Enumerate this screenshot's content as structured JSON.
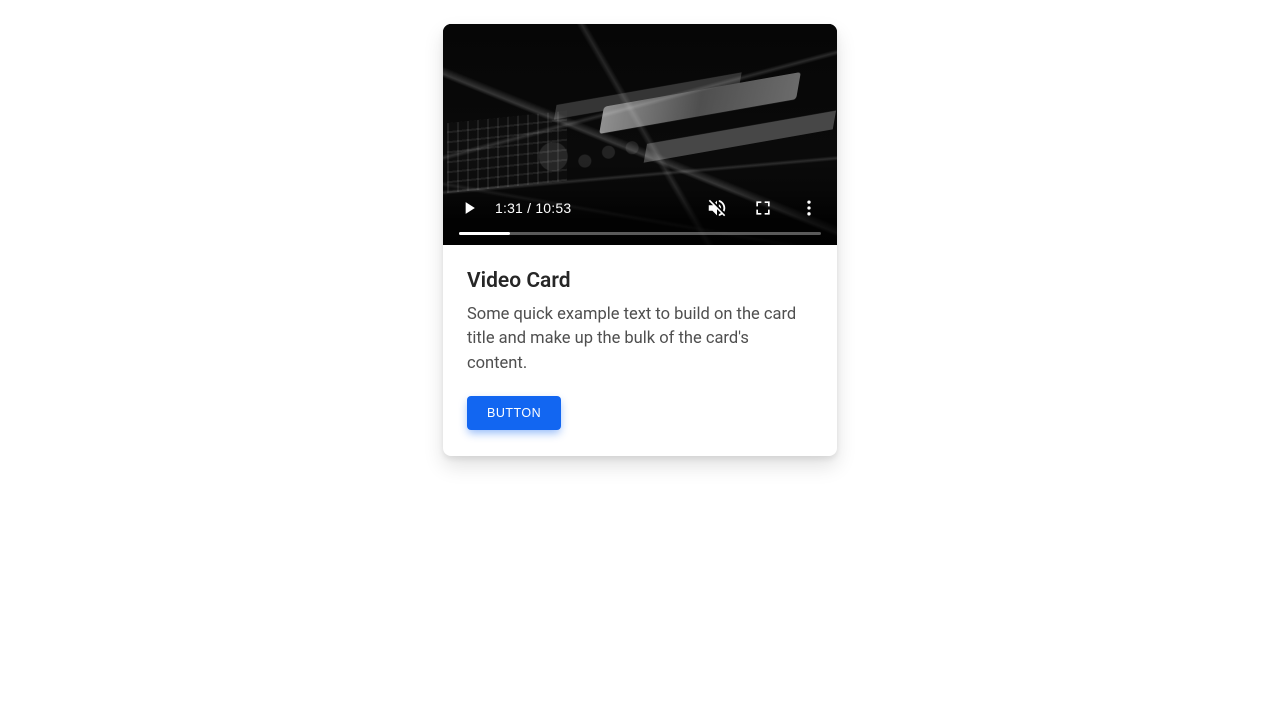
{
  "video": {
    "current_time": "1:31",
    "total_time": "10:53",
    "time_display": "1:31 / 10:53",
    "progress_fraction": 0.14,
    "muted": true,
    "icons": {
      "play": "play-icon",
      "mute": "mute-icon",
      "fullscreen": "fullscreen-icon",
      "more": "more-icon"
    }
  },
  "card": {
    "title": "Video Card",
    "text": "Some quick example text to build on the card title and make up the bulk of the card's content.",
    "button_label": "Button"
  },
  "colors": {
    "primary": "#1266F1",
    "title": "#262626",
    "body_text": "#4f4f4f"
  }
}
